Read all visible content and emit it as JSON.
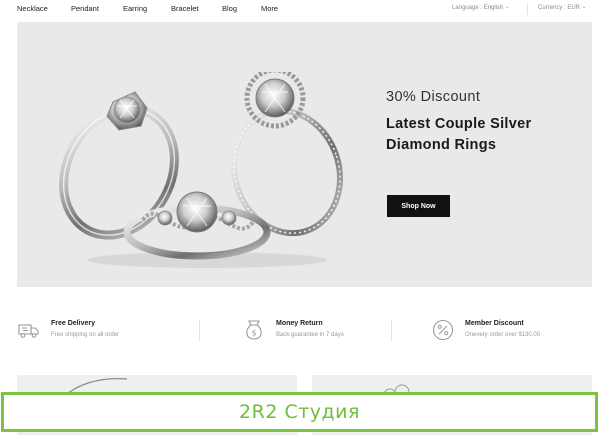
{
  "nav": {
    "items": [
      "Necklace",
      "Pendant",
      "Earring",
      "Bracelet",
      "Blog",
      "More"
    ],
    "language": "Language : English",
    "currency": "Currency : EUR"
  },
  "hero": {
    "discount": "30% Discount",
    "title_line1": "Latest Couple Silver",
    "title_line2": "Diamond Rings",
    "button": "Shop Now"
  },
  "features": [
    {
      "icon": "truck-icon",
      "title": "Free Delivery",
      "subtitle": "Free shipping on all order"
    },
    {
      "icon": "money-return-icon",
      "title": "Money Return",
      "subtitle": "Back guarantee in 7 days"
    },
    {
      "icon": "percent-badge-icon",
      "title": "Member Discount",
      "subtitle": "Onevery order over $130.00"
    }
  ],
  "watermark": "2R2 Студия",
  "colors": {
    "watermark_border": "#7cc243",
    "watermark_text": "#6cbf3a",
    "button_bg": "#111111",
    "hero_bg": "#e9e9e8"
  }
}
